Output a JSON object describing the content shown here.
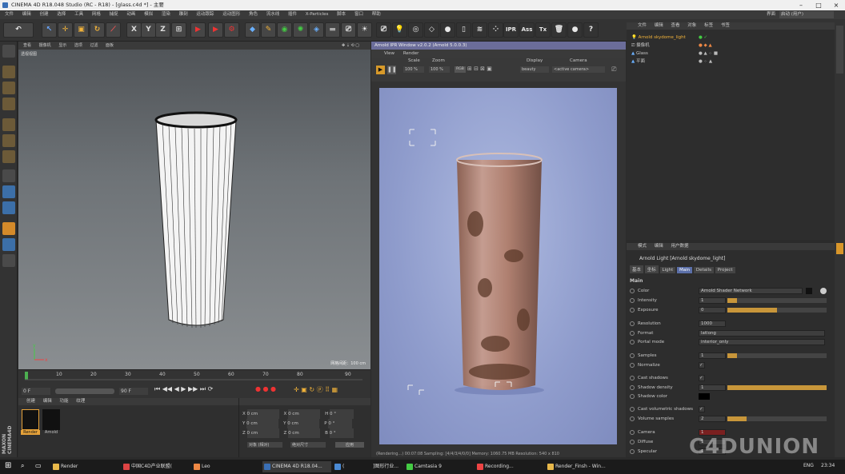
{
  "window": {
    "title": "CINEMA 4D R18.048 Studio (RC - R18) - [glass.c4d *] - 主要"
  },
  "menu": [
    "文件",
    "编辑",
    "创建",
    "选择",
    "工具",
    "网格",
    "捕捉",
    "动画",
    "模拟",
    "渲染",
    "雕刻",
    "运动跟踪",
    "运动图形",
    "角色",
    "流水线",
    "插件",
    "X-Particles",
    "脚本",
    "窗口",
    "帮助"
  ],
  "layout": {
    "label": "界面",
    "value": "启动 (用户)"
  },
  "viewport": {
    "menu": [
      "查看",
      "摄像机",
      "显示",
      "选项",
      "过滤",
      "面板"
    ],
    "view_label": "透视视图",
    "grid_info": "网格间距：100 cm"
  },
  "timeline": {
    "ticks": [
      "0",
      "10",
      "20",
      "30",
      "40",
      "50",
      "60",
      "70",
      "80",
      "90"
    ],
    "start": "0 F",
    "end": "90 F",
    "cur": "0 F"
  },
  "materials": {
    "menu": [
      "创建",
      "编辑",
      "功能",
      "纹理"
    ],
    "items": [
      "Render",
      "Arnold"
    ]
  },
  "coords": {
    "rows": [
      [
        "X",
        "0 cm",
        "X",
        "0 cm",
        "H",
        "0 °"
      ],
      [
        "Y",
        "0 cm",
        "Y",
        "0 cm",
        "P",
        "0 °"
      ],
      [
        "Z",
        "0 cm",
        "Z",
        "0 cm",
        "B",
        "0 °"
      ]
    ],
    "mode1": "对象 (相对)",
    "mode2": "绝对尺寸",
    "apply": "应用"
  },
  "ipr": {
    "title": "Arnold IPR Window v2.0.2 (Arnold 5.0.0.3)",
    "menu": [
      "View",
      "Render"
    ],
    "scale_label": "Scale",
    "scale": "100 %",
    "zoom_label": "Zoom",
    "zoom": "100 %",
    "display_label": "Display",
    "display": "beauty",
    "camera_label": "Camera",
    "camera": "<active camera>",
    "status": "(Rendering...)   00:07:08  Sampling: [4/4/3/4/0/0]  Memory: 1060.75 MB  Resolution: 540 x 810"
  },
  "objects": {
    "menu": [
      "文件",
      "编辑",
      "查看",
      "对象",
      "标签",
      "书签"
    ],
    "items": [
      "Arnold skydome_light",
      "摄像机",
      "Glass",
      "平面"
    ]
  },
  "attributes": {
    "menu": [
      "模式",
      "编辑",
      "用户数据"
    ],
    "header": "Arnold Light [Arnold skydome_light]",
    "tabs": [
      "基本",
      "坐标",
      "Light",
      "Main",
      "Details",
      "Project"
    ],
    "section": "Main",
    "rows": [
      {
        "label": "Color",
        "value": "Arnold Shader Network"
      },
      {
        "label": "Intensity",
        "value": "1"
      },
      {
        "label": "Exposure",
        "value": "0"
      },
      {
        "label": "Resolution",
        "value": "1000"
      },
      {
        "label": "Format",
        "value": "latlong"
      },
      {
        "label": "Portal mode",
        "value": "interior_only"
      },
      {
        "label": "Samples",
        "value": "1"
      },
      {
        "label": "Normalize",
        "value": "✓"
      },
      {
        "label": "Cast shadows",
        "value": "✓"
      },
      {
        "label": "Shadow density",
        "value": "1"
      },
      {
        "label": "Shadow color",
        "value": ""
      },
      {
        "label": "Cast volumetric shadows",
        "value": "✓"
      },
      {
        "label": "Volume samples",
        "value": "2"
      },
      {
        "label": "Camera",
        "value": "1"
      },
      {
        "label": "Diffuse",
        "value": "1"
      },
      {
        "label": "Specular",
        "value": "1"
      }
    ]
  },
  "taskbar": {
    "items": [
      "Render",
      "中国C4D产业联盟(",
      "Leo",
      "CINEMA 4D R18.04...",
      "(",
      "]图形行业...",
      "Camtasia 9",
      "Recording...",
      "Render_Finsh - Win..."
    ],
    "time": "23:34",
    "lang": "ENG"
  },
  "watermark": "C4DUNION"
}
